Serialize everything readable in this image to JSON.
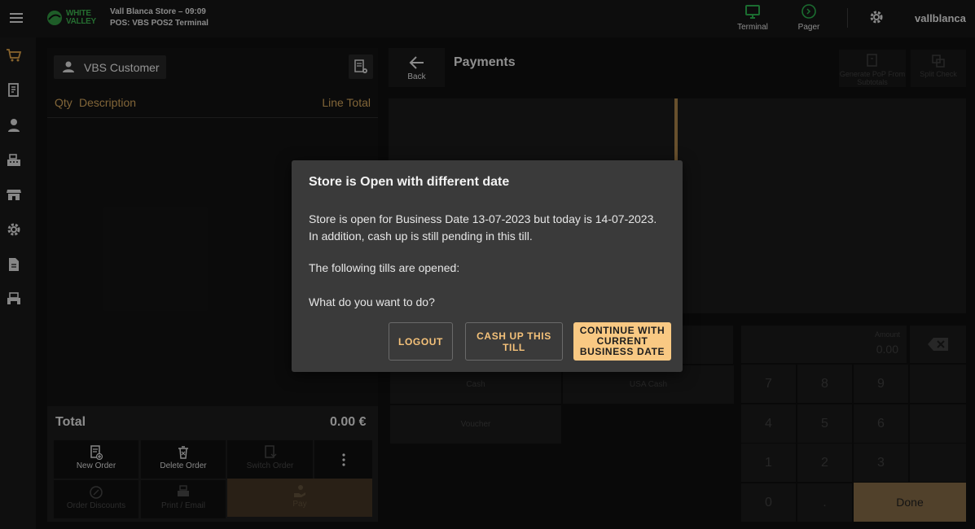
{
  "header": {
    "logo_line1": "WHITE",
    "logo_line2": "VALLEY",
    "store_line": "Vall Blanca Store – 09:09",
    "pos_line": "POS: VBS POS2 Terminal",
    "terminal_label": "Terminal",
    "pager_label": "Pager",
    "username": "vallblanca",
    "accent_green": "#2aa84a"
  },
  "sidebar": {
    "items": [
      "cart-icon",
      "receipt-icon",
      "person-icon",
      "cash-register-icon",
      "store-icon",
      "gear-icon",
      "document-icon",
      "printer-icon"
    ]
  },
  "order": {
    "customer": "VBS Customer",
    "col_qty": "Qty",
    "col_description": "Description",
    "col_line_total": "Line Total",
    "total_label": "Total",
    "total_value": "0.00 €",
    "buttons": {
      "new_order": "New Order",
      "delete_order": "Delete Order",
      "switch_order": "Switch Order",
      "order_discounts": "Order Discounts",
      "print_email": "Print / Email",
      "pay": "Pay"
    }
  },
  "payments": {
    "back_label": "Back",
    "title": "Payments",
    "generate_pop": "Generate PoP From Subtotals",
    "split_check": "Split Check",
    "tenders": {
      "cash": "Cash",
      "usa_cash": "USA Cash",
      "voucher": "Voucher"
    },
    "amount_label": "Amount",
    "amount_value": "0.00",
    "keys": [
      "7",
      "8",
      "9",
      "4",
      "5",
      "6",
      "1",
      "2",
      "3",
      "0",
      "."
    ],
    "done_label": "Done"
  },
  "dialog": {
    "title": "Store is Open with different date",
    "message": "Store is open for Business Date 13-07-2023 but today is 14-07-2023. In addition, cash up is still pending in this till.",
    "tills": "The following tills are opened:",
    "question": "What do you want to do?",
    "logout": "LOGOUT",
    "cash_up": "CASH UP THIS TILL",
    "continue": "CONTINUE WITH CURRENT BUSINESS DATE",
    "accent": "#f9c983"
  }
}
